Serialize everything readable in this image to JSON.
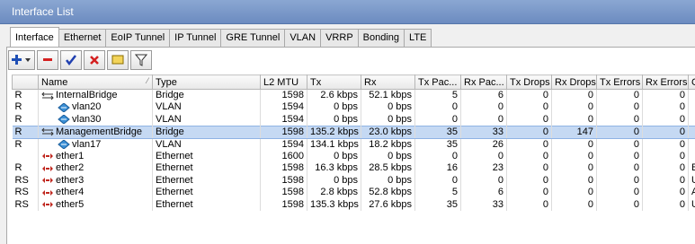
{
  "window": {
    "title": "Interface List"
  },
  "tabs": [
    "Interface",
    "Ethernet",
    "EoIP Tunnel",
    "IP Tunnel",
    "GRE Tunnel",
    "VLAN",
    "VRRP",
    "Bonding",
    "LTE"
  ],
  "toolbar": {
    "add": "add-icon",
    "remove": "remove-icon",
    "enable": "check-icon",
    "disable": "cross-icon",
    "comment": "comment-icon",
    "filter": "filter-icon"
  },
  "table": {
    "columns": [
      "",
      "Name",
      "Type",
      "L2 MTU",
      "Tx",
      "Rx",
      "Tx Pac...",
      "Rx Pac...",
      "Tx Drops",
      "Rx Drops",
      "Tx Errors",
      "Rx Errors",
      "Co"
    ],
    "rows": [
      {
        "flags": "R",
        "name": "InternalBridge",
        "icon": "bridge",
        "level": 0,
        "type": "Bridge",
        "mtu": "1598",
        "tx": "2.6 kbps",
        "rx": "52.1 kbps",
        "txp": "5",
        "rxp": "6",
        "txd": "0",
        "rxd": "0",
        "txe": "0",
        "rxe": "0",
        "co": "",
        "selected": false
      },
      {
        "flags": "R",
        "name": "vlan20",
        "icon": "vlan",
        "level": 1,
        "type": "VLAN",
        "mtu": "1594",
        "tx": "0 bps",
        "rx": "0 bps",
        "txp": "0",
        "rxp": "0",
        "txd": "0",
        "rxd": "0",
        "txe": "0",
        "rxe": "0",
        "co": "",
        "selected": false
      },
      {
        "flags": "R",
        "name": "vlan30",
        "icon": "vlan",
        "level": 1,
        "type": "VLAN",
        "mtu": "1594",
        "tx": "0 bps",
        "rx": "0 bps",
        "txp": "0",
        "rxp": "0",
        "txd": "0",
        "rxd": "0",
        "txe": "0",
        "rxe": "0",
        "co": "",
        "selected": false
      },
      {
        "flags": "R",
        "name": "ManagementBridge",
        "icon": "bridge",
        "level": 0,
        "type": "Bridge",
        "mtu": "1598",
        "tx": "135.2 kbps",
        "rx": "23.0 kbps",
        "txp": "35",
        "rxp": "33",
        "txd": "0",
        "rxd": "147",
        "txe": "0",
        "rxe": "0",
        "co": "",
        "selected": true
      },
      {
        "flags": "R",
        "name": "vlan17",
        "icon": "vlan",
        "level": 1,
        "type": "VLAN",
        "mtu": "1594",
        "tx": "134.1 kbps",
        "rx": "18.2 kbps",
        "txp": "35",
        "rxp": "26",
        "txd": "0",
        "rxd": "0",
        "txe": "0",
        "rxe": "0",
        "co": "",
        "selected": false
      },
      {
        "flags": "",
        "name": "ether1",
        "icon": "ethernet",
        "level": 0,
        "type": "Ethernet",
        "mtu": "1600",
        "tx": "0 bps",
        "rx": "0 bps",
        "txp": "0",
        "rxp": "0",
        "txd": "0",
        "rxd": "0",
        "txe": "0",
        "rxe": "0",
        "co": "",
        "selected": false
      },
      {
        "flags": "R",
        "name": "ether2",
        "icon": "ethernet",
        "level": 0,
        "type": "Ethernet",
        "mtu": "1598",
        "tx": "16.3 kbps",
        "rx": "28.5 kbps",
        "txp": "16",
        "rxp": "23",
        "txd": "0",
        "rxd": "0",
        "txe": "0",
        "rxe": "0",
        "co": "Bro",
        "selected": false
      },
      {
        "flags": "RS",
        "name": "ether3",
        "icon": "ethernet",
        "level": 0,
        "type": "Ethernet",
        "mtu": "1598",
        "tx": "0 bps",
        "rx": "0 bps",
        "txp": "0",
        "rxp": "0",
        "txd": "0",
        "rxd": "0",
        "txe": "0",
        "rxe": "0",
        "co": "Un",
        "selected": false
      },
      {
        "flags": "RS",
        "name": "ether4",
        "icon": "ethernet",
        "level": 0,
        "type": "Ethernet",
        "mtu": "1598",
        "tx": "2.8 kbps",
        "rx": "52.8 kbps",
        "txp": "5",
        "rxp": "6",
        "txd": "0",
        "rxd": "0",
        "txe": "0",
        "rxe": "0",
        "co": "AP",
        "selected": false
      },
      {
        "flags": "RS",
        "name": "ether5",
        "icon": "ethernet",
        "level": 0,
        "type": "Ethernet",
        "mtu": "1598",
        "tx": "135.3 kbps",
        "rx": "27.6 kbps",
        "txp": "35",
        "rxp": "33",
        "txd": "0",
        "rxd": "0",
        "txe": "0",
        "rxe": "0",
        "co": "Up",
        "selected": false
      }
    ]
  },
  "colors": {
    "titlebar": "#7b99c9",
    "selected_row": "#c5d9f3",
    "add": "#1f4fb5",
    "remove": "#d42020",
    "check": "#1f3fb0",
    "cross": "#d42020",
    "comment": "#f3d45a"
  }
}
